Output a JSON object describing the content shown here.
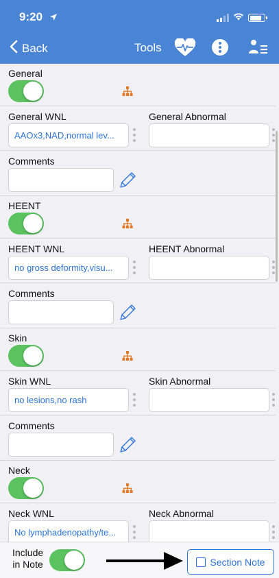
{
  "status_bar": {
    "time": "9:20"
  },
  "nav": {
    "back_label": "Back",
    "tools_label": "Tools"
  },
  "sections": [
    {
      "toggle_label": "General",
      "wnl_label": "General WNL",
      "wnl_value": "AAOx3,NAD,normal lev...",
      "abnormal_label": "General Abnormal",
      "abnormal_value": "",
      "comments_label": "Comments",
      "comments_value": "",
      "enabled": true
    },
    {
      "toggle_label": "HEENT",
      "wnl_label": "HEENT WNL",
      "wnl_value": "no gross deformity,visu...",
      "abnormal_label": "HEENT Abnormal",
      "abnormal_value": "",
      "comments_label": "Comments",
      "comments_value": "",
      "enabled": true
    },
    {
      "toggle_label": "Skin",
      "wnl_label": "Skin WNL",
      "wnl_value": "no lesions,no rash",
      "abnormal_label": "Skin Abnormal",
      "abnormal_value": "",
      "comments_label": "Comments",
      "comments_value": "",
      "enabled": true
    },
    {
      "toggle_label": "Neck",
      "wnl_label": "Neck WNL",
      "wnl_value": "No lymphadenopathy/te...",
      "abnormal_label": "Neck Abnormal",
      "abnormal_value": "",
      "enabled": true
    }
  ],
  "footer": {
    "include_line1": "Include",
    "include_line2": "in Note",
    "include_enabled": true,
    "section_note_label": "Section Note"
  },
  "colors": {
    "header": "#4a84d4",
    "toggle_on": "#5bc260",
    "accent": "#2c74d9",
    "tree_icon": "#e07a28"
  }
}
